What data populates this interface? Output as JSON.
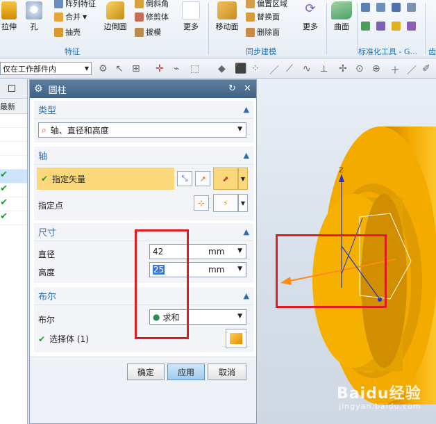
{
  "ribbon": {
    "extrude_label": "拉伸",
    "hole_label": "孔",
    "pattern_feature_label": "阵列特征",
    "unite_label": "合并",
    "shell_label": "抽壳",
    "edge_blend_label": "边倒圆",
    "chamfer_label": "倒斜角",
    "trim_body_label": "修剪体",
    "draft_label": "拔模",
    "more_label_1": "更多",
    "move_face_label": "移动面",
    "offset_region_label": "偏置区域",
    "replace_face_label": "替换面",
    "delete_face_label": "删除面",
    "more_label_2": "更多",
    "surface_label": "曲面",
    "group_feature": "特征",
    "group_sync": "同步建模",
    "group_standard": "标准化工具 - G...",
    "group_right": "齿"
  },
  "toolbar": {
    "filter_value": "仅在工作部件内"
  },
  "leftnav": {
    "latest_label": "最新"
  },
  "dialog": {
    "title": "圆柱",
    "type_section": "类型",
    "type_value": "轴、直径和高度",
    "axis_section": "轴",
    "specify_vector": "指定矢量",
    "specify_point": "指定点",
    "dimensions_section": "尺寸",
    "diameter_label": "直径",
    "diameter_value": "42",
    "diameter_unit": "mm",
    "height_label": "高度",
    "height_value": "25",
    "height_unit": "mm",
    "boolean_section": "布尔",
    "boolean_label": "布尔",
    "boolean_value": "求和",
    "select_body": "选择体 (1)",
    "ok": "确定",
    "apply": "应用",
    "cancel": "取消"
  },
  "viewport": {
    "axis_z_label": "Z"
  },
  "watermark": {
    "text": "Baidu经验",
    "sub": "jingyan.baidu.com"
  },
  "colors": {
    "part_orange": "#f2a900",
    "part_dark": "#c47d00",
    "accent_blue": "#2f6fae",
    "highlight_yellow": "#fbd97a",
    "annotation_red": "#e01b22"
  }
}
